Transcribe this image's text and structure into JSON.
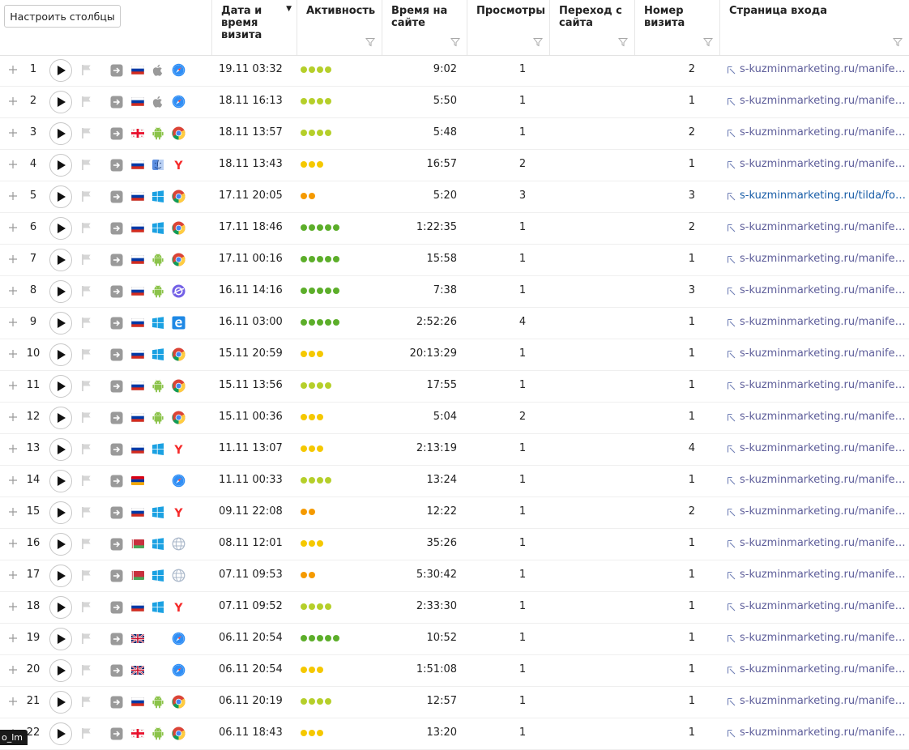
{
  "toolbar": {
    "configure_columns_label": "Настроить столбцы"
  },
  "columns": [
    {
      "key": "date",
      "label": "Дата и\nвремя\nвизита",
      "sort": "▼"
    },
    {
      "key": "activity",
      "label": "Активность"
    },
    {
      "key": "time",
      "label": "Время на\nсайте"
    },
    {
      "key": "views",
      "label": "Просмотры"
    },
    {
      "key": "referrer",
      "label": "Переход с\nсайта"
    },
    {
      "key": "visitnum",
      "label": "Номер\nвизита"
    },
    {
      "key": "entry",
      "label": "Страница входа"
    }
  ],
  "colors": {
    "url": "#5e5e9a",
    "url_highlight": "#1a5ea8",
    "activity": {
      "2": "#f59a00",
      "3": "#f5c800",
      "4": "#b5cf2a",
      "5": "#5cae2a"
    }
  },
  "rows": [
    {
      "n": "1",
      "country": "ru",
      "os": "apple-icon",
      "browser": "safari-icon",
      "date": "19.11 03:32",
      "activity": 4,
      "time": "9:02",
      "views": "1",
      "visit": "2",
      "url": "s-kuzminmarketing.ru/manifesto_"
    },
    {
      "n": "2",
      "country": "ru",
      "os": "apple-icon",
      "browser": "safari-icon",
      "date": "18.11 16:13",
      "activity": 4,
      "time": "5:50",
      "views": "1",
      "visit": "1",
      "url": "s-kuzminmarketing.ru/manifesto_"
    },
    {
      "n": "3",
      "country": "ge",
      "os": "android-icon",
      "browser": "chrome-icon",
      "date": "18.11 13:57",
      "activity": 4,
      "time": "5:48",
      "views": "1",
      "visit": "2",
      "url": "s-kuzminmarketing.ru/manifesto_"
    },
    {
      "n": "4",
      "country": "ru",
      "os": "finder-icon",
      "browser": "yandex-icon",
      "date": "18.11 13:43",
      "activity": 3,
      "time": "16:57",
      "views": "2",
      "visit": "1",
      "url": "s-kuzminmarketing.ru/manifesto_"
    },
    {
      "n": "5",
      "country": "ru",
      "os": "windows-icon",
      "browser": "chrome-icon",
      "date": "17.11 20:05",
      "activity": 2,
      "time": "5:20",
      "views": "3",
      "visit": "3",
      "url": "s-kuzminmarketing.ru/tilda/form",
      "highlight": true
    },
    {
      "n": "6",
      "country": "ru",
      "os": "windows-icon",
      "browser": "chrome-icon",
      "date": "17.11 18:46",
      "activity": 5,
      "time": "1:22:35",
      "views": "1",
      "visit": "2",
      "url": "s-kuzminmarketing.ru/manifesto_"
    },
    {
      "n": "7",
      "country": "ru",
      "os": "android-icon",
      "browser": "chrome-icon",
      "date": "17.11 00:16",
      "activity": 5,
      "time": "15:58",
      "views": "1",
      "visit": "1",
      "url": "s-kuzminmarketing.ru/manifesto_"
    },
    {
      "n": "8",
      "country": "ru",
      "os": "android-icon",
      "browser": "samsung-internet-icon",
      "date": "16.11 14:16",
      "activity": 5,
      "time": "7:38",
      "views": "1",
      "visit": "3",
      "url": "s-kuzminmarketing.ru/manifesto_"
    },
    {
      "n": "9",
      "country": "ru",
      "os": "windows-icon",
      "browser": "edge-icon",
      "date": "16.11 03:00",
      "activity": 5,
      "time": "2:52:26",
      "views": "4",
      "visit": "1",
      "url": "s-kuzminmarketing.ru/manifesto_"
    },
    {
      "n": "10",
      "country": "ru",
      "os": "windows-icon",
      "browser": "chrome-icon",
      "date": "15.11 20:59",
      "activity": 3,
      "time": "20:13:29",
      "views": "1",
      "visit": "1",
      "url": "s-kuzminmarketing.ru/manifesto_"
    },
    {
      "n": "11",
      "country": "ru",
      "os": "android-icon",
      "browser": "chrome-icon",
      "date": "15.11 13:56",
      "activity": 4,
      "time": "17:55",
      "views": "1",
      "visit": "1",
      "url": "s-kuzminmarketing.ru/manifesto_"
    },
    {
      "n": "12",
      "country": "ru",
      "os": "android-icon",
      "browser": "chrome-icon",
      "date": "15.11 00:36",
      "activity": 3,
      "time": "5:04",
      "views": "2",
      "visit": "1",
      "url": "s-kuzminmarketing.ru/manifesto_"
    },
    {
      "n": "13",
      "country": "ru",
      "os": "windows-icon",
      "browser": "yandex-icon",
      "date": "11.11 13:07",
      "activity": 3,
      "time": "2:13:19",
      "views": "1",
      "visit": "4",
      "url": "s-kuzminmarketing.ru/manifesto_"
    },
    {
      "n": "14",
      "country": "am",
      "os": "",
      "browser": "safari-icon",
      "date": "11.11 00:33",
      "activity": 4,
      "time": "13:24",
      "views": "1",
      "visit": "1",
      "url": "s-kuzminmarketing.ru/manifesto_"
    },
    {
      "n": "15",
      "country": "ru",
      "os": "windows-icon",
      "browser": "yandex-icon",
      "date": "09.11 22:08",
      "activity": 2,
      "time": "12:22",
      "views": "1",
      "visit": "2",
      "url": "s-kuzminmarketing.ru/manifesto_"
    },
    {
      "n": "16",
      "country": "by",
      "os": "windows-icon",
      "browser": "globe-icon",
      "date": "08.11 12:01",
      "activity": 3,
      "time": "35:26",
      "views": "1",
      "visit": "1",
      "url": "s-kuzminmarketing.ru/manifesto_"
    },
    {
      "n": "17",
      "country": "by",
      "os": "windows-icon",
      "browser": "globe-icon",
      "date": "07.11 09:53",
      "activity": 2,
      "time": "5:30:42",
      "views": "1",
      "visit": "1",
      "url": "s-kuzminmarketing.ru/manifesto_"
    },
    {
      "n": "18",
      "country": "ru",
      "os": "windows-icon",
      "browser": "yandex-icon",
      "date": "07.11 09:52",
      "activity": 4,
      "time": "2:33:30",
      "views": "1",
      "visit": "1",
      "url": "s-kuzminmarketing.ru/manifesto_"
    },
    {
      "n": "19",
      "country": "gb",
      "os": "",
      "browser": "safari-icon",
      "date": "06.11 20:54",
      "activity": 5,
      "time": "10:52",
      "views": "1",
      "visit": "1",
      "url": "s-kuzminmarketing.ru/manifesto_"
    },
    {
      "n": "20",
      "country": "gb",
      "os": "",
      "browser": "safari-icon",
      "date": "06.11 20:54",
      "activity": 3,
      "time": "1:51:08",
      "views": "1",
      "visit": "1",
      "url": "s-kuzminmarketing.ru/manifesto_"
    },
    {
      "n": "21",
      "country": "ru",
      "os": "android-icon",
      "browser": "chrome-icon",
      "date": "06.11 20:19",
      "activity": 4,
      "time": "12:57",
      "views": "1",
      "visit": "1",
      "url": "s-kuzminmarketing.ru/manifesto_"
    },
    {
      "n": "22",
      "country": "ge",
      "os": "android-icon",
      "browser": "chrome-icon",
      "date": "06.11 18:43",
      "activity": 3,
      "time": "13:20",
      "views": "1",
      "visit": "1",
      "url": "s-kuzminmarketing.ru/manifesto_"
    }
  ],
  "tooltip": {
    "text": "o_lm"
  }
}
